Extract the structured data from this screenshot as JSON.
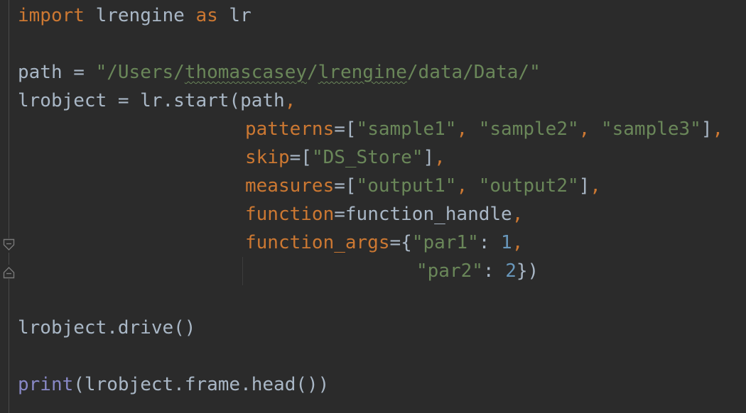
{
  "code": {
    "line1": {
      "kw_import": "import",
      "module": " lrengine ",
      "kw_as": "as",
      "alias": " lr"
    },
    "line2": {
      "var": "path = ",
      "str_open": "\"/Users/",
      "str_user": "thomascasey",
      "str_mid": "/",
      "str_pkg": "lrengine",
      "str_end": "/data/Data/\""
    },
    "line3": {
      "text": "lrobject = lr.start(path",
      "comma": ","
    },
    "line4": {
      "param": "patterns",
      "eq_bracket": "=[",
      "s1": "\"sample1\"",
      "c1": ", ",
      "s2": "\"sample2\"",
      "c2": ", ",
      "s3": "\"sample3\"",
      "close": "]",
      "comma": ","
    },
    "line5": {
      "param": "skip",
      "eq_bracket": "=[",
      "s1": "\"DS_Store\"",
      "close": "]",
      "comma": ","
    },
    "line6": {
      "param": "measures",
      "eq_bracket": "=[",
      "s1": "\"output1\"",
      "c1": ", ",
      "s2": "\"output2\"",
      "close": "]",
      "comma": ","
    },
    "line7": {
      "param": "function",
      "rest": "=function_handle",
      "comma": ","
    },
    "line8": {
      "param": "function_args",
      "eq_brace": "={",
      "key": "\"par1\"",
      "colon": ": ",
      "num": "1",
      "comma": ","
    },
    "line9": {
      "key": "\"par2\"",
      "colon": ": ",
      "num": "2",
      "close": "})"
    },
    "line10": {
      "text": "lrobject.drive()"
    },
    "line11": {
      "builtin": "print",
      "rest": "(lrobject.frame.head())"
    }
  },
  "colors": {
    "background": "#2b2b2b",
    "default_text": "#a9b7c6",
    "keyword": "#cc7832",
    "string": "#6a8759",
    "number": "#6897bb",
    "builtin": "#8888c6"
  },
  "icons": {
    "fold_start": "fold-start-icon",
    "fold_end": "fold-end-icon"
  }
}
